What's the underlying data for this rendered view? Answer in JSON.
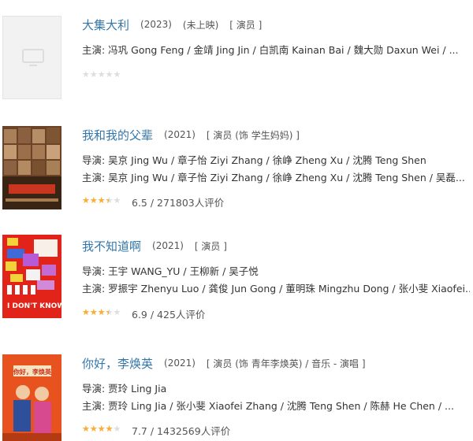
{
  "items": [
    {
      "title": "大集大利",
      "year": "(2023)",
      "status": "(未上映)",
      "role": "[ 演员 ]",
      "lines": [
        "主演: 冯巩 Gong Feng / 金靖 Jing Jin / 白凯南 Kainan Bai / 魏大勋 Daxun Wei / ..."
      ],
      "rating": {
        "stars": 0,
        "text": ""
      },
      "poster": "placeholder-poster"
    },
    {
      "title": "我和我的父辈",
      "year": "(2021)",
      "role": "[ 演员 (饰 学生妈妈) ]",
      "lines": [
        "导演: 吴京 Jing Wu / 章子怡 Ziyi Zhang / 徐峥 Zheng Xu / 沈腾 Teng Shen",
        "主演: 吴京 Jing Wu / 章子怡 Ziyi Zhang / 徐峥 Zheng Xu / 沈腾 Teng Shen / 吴磊..."
      ],
      "rating": {
        "stars": 3.5,
        "text": "6.5 / 271803人评价"
      },
      "poster": "poster-father"
    },
    {
      "title": "我不知道啊",
      "year": "(2021)",
      "role": "[ 演员 ]",
      "lines": [
        "导演: 王宇 WANG_YU / 王柳新 / 吴子悦",
        "主演: 罗振宇 Zhenyu Luo / 龚俊 Jun Gong / 董明珠 Mingzhu Dong / 张小斐 Xiaofei..."
      ],
      "rating": {
        "stars": 3.5,
        "text": "6.9 / 425人评价"
      },
      "poster": "poster-idontknow"
    },
    {
      "title": "你好，李焕英",
      "year": "(2021)",
      "role": "[ 演员 (饰 青年李焕英) / 音乐 - 演唱 ]",
      "lines": [
        "导演: 贾玲 Ling Jia",
        "主演: 贾玲 Ling Jia / 张小斐 Xiaofei Zhang / 沈腾 Teng Shen / 陈赫 He Chen / ..."
      ],
      "rating": {
        "stars": 4,
        "text": "7.7 / 1432569人评价"
      },
      "poster": "poster-hilihuanying"
    }
  ],
  "colors": {
    "link": "#3377aa",
    "star": "#ffac2d",
    "star_empty": "#dddddd"
  },
  "poster_texts": {
    "idontknow": "I DON'T KNOW",
    "hilihuanying": "你好，李焕英"
  }
}
